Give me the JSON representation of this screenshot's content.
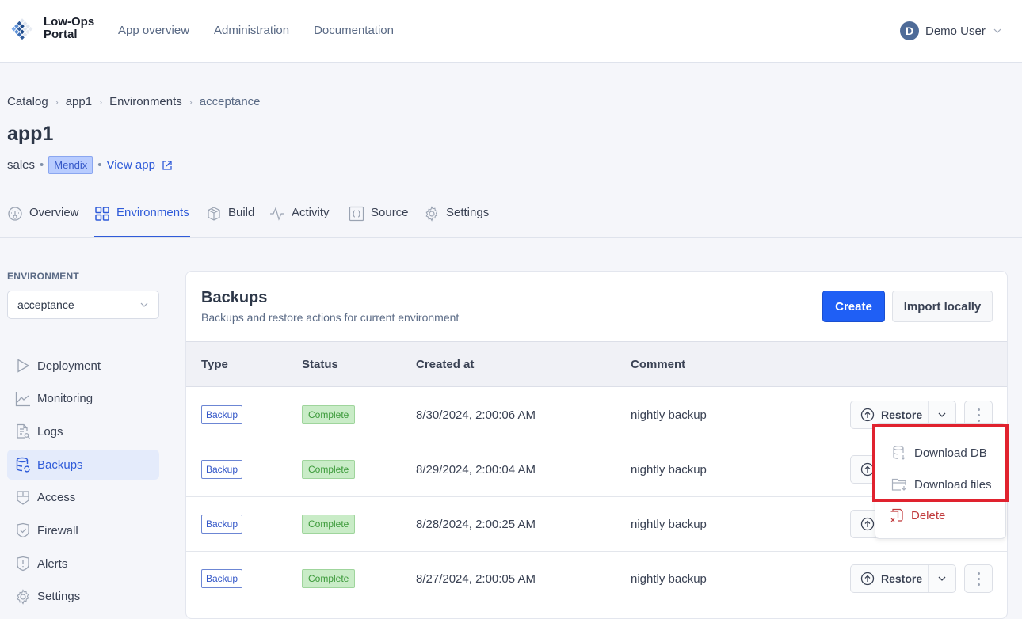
{
  "header": {
    "logo_line1": "Low-Ops",
    "logo_line2": "Portal",
    "nav": [
      "App overview",
      "Administration",
      "Documentation"
    ],
    "user": {
      "initial": "D",
      "name": "Demo User"
    }
  },
  "breadcrumb": [
    "Catalog",
    "app1",
    "Environments",
    "acceptance"
  ],
  "app": {
    "title": "app1",
    "team": "sales",
    "platform_badge": "Mendix",
    "view_app_label": "View app"
  },
  "tabs": [
    {
      "label": "Overview",
      "icon": "gauge-icon"
    },
    {
      "label": "Environments",
      "icon": "grid-icon",
      "active": true
    },
    {
      "label": "Build",
      "icon": "box-icon"
    },
    {
      "label": "Activity",
      "icon": "activity-icon"
    },
    {
      "label": "Source",
      "icon": "code-braces-icon"
    },
    {
      "label": "Settings",
      "icon": "gear-icon"
    }
  ],
  "sidebar": {
    "env_label": "ENVIRONMENT",
    "env_selected": "acceptance",
    "items": [
      {
        "label": "Deployment",
        "icon": "play-icon"
      },
      {
        "label": "Monitoring",
        "icon": "chart-line-icon"
      },
      {
        "label": "Logs",
        "icon": "log-search-icon"
      },
      {
        "label": "Backups",
        "icon": "database-sync-icon",
        "active": true
      },
      {
        "label": "Access",
        "icon": "shield-grid-icon"
      },
      {
        "label": "Firewall",
        "icon": "shield-check-icon"
      },
      {
        "label": "Alerts",
        "icon": "shield-alert-icon"
      },
      {
        "label": "Settings",
        "icon": "gear-icon"
      }
    ]
  },
  "backups": {
    "title": "Backups",
    "subtitle": "Backups and restore actions for current environment",
    "create_label": "Create",
    "import_label": "Import locally",
    "columns": [
      "Type",
      "Status",
      "Created at",
      "Comment"
    ],
    "restore_label": "Restore",
    "rows": [
      {
        "type": "Backup",
        "status": "Complete",
        "created_at": "8/30/2024, 2:00:06 AM",
        "comment": "nightly backup"
      },
      {
        "type": "Backup",
        "status": "Complete",
        "created_at": "8/29/2024, 2:00:04 AM",
        "comment": "nightly backup"
      },
      {
        "type": "Backup",
        "status": "Complete",
        "created_at": "8/28/2024, 2:00:25 AM",
        "comment": "nightly backup"
      },
      {
        "type": "Backup",
        "status": "Complete",
        "created_at": "8/27/2024, 2:00:05 AM",
        "comment": "nightly backup"
      }
    ]
  },
  "row_menu": {
    "items": [
      {
        "label": "Download DB",
        "icon": "database-download-icon"
      },
      {
        "label": "Download files",
        "icon": "folder-download-icon"
      },
      {
        "label": "Delete",
        "icon": "delete-icon",
        "danger": true
      }
    ]
  },
  "colors": {
    "accent": "#1f5ff5",
    "link": "#2f5bd9",
    "status_complete": "#c9ecc7",
    "danger": "#c0393b",
    "highlight": "#e0222e"
  }
}
